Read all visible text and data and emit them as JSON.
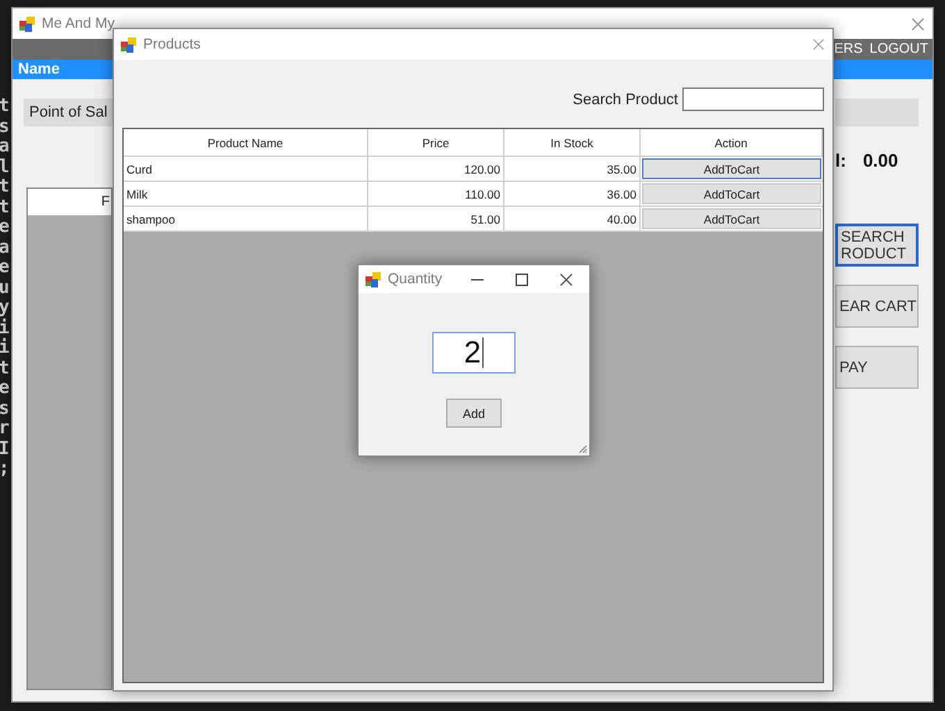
{
  "code_editor": {
    "margin_chars": [
      "t",
      "s",
      "a",
      "l",
      "t",
      "t",
      "e",
      "a",
      "e",
      "u",
      "y",
      "i",
      "i",
      "t",
      "e",
      "s",
      "r",
      "I",
      ";"
    ]
  },
  "main_window": {
    "title": "Me And My",
    "menu": [
      "ERS",
      "LOGOUT"
    ],
    "header": "Name",
    "pos_title": "Point of Sal",
    "total_label": "l:",
    "total_value": "0.00",
    "cart_header": "F",
    "buttons": [
      {
        "label": "SEARCH RODUCT",
        "focused": true
      },
      {
        "label": "EAR CART",
        "focused": false
      },
      {
        "label": "PAY",
        "focused": false
      }
    ]
  },
  "products_window": {
    "title": "Products",
    "search_label": "Search Product",
    "columns": [
      "Product Name",
      "Price",
      "In Stock",
      "Action"
    ],
    "rows": [
      {
        "name": "Curd",
        "price": "120.00",
        "stock": "35.00",
        "action": "AddToCart",
        "focused": true
      },
      {
        "name": "Milk",
        "price": "110.00",
        "stock": "36.00",
        "action": "AddToCart",
        "focused": false
      },
      {
        "name": "shampoo",
        "price": "51.00",
        "stock": "40.00",
        "action": "AddToCart",
        "focused": false
      }
    ]
  },
  "quantity_dialog": {
    "title": "Quantity",
    "value": "2",
    "button": "Add"
  }
}
